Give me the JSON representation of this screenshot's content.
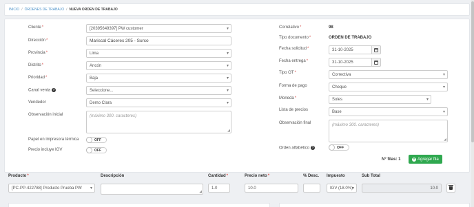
{
  "breadcrumb": {
    "items": [
      "INICIO",
      "ÓRDENES DE TRABAJO"
    ],
    "separator": "/",
    "current": "NUEVA ORDEN DE TRABAJO"
  },
  "left_form": {
    "cliente": {
      "label": "Cliente",
      "value": "[20395649397] PW customer"
    },
    "direccion": {
      "label": "Dirección",
      "value": "Mariscal Cáceres 205 - Surco"
    },
    "provincia": {
      "label": "Provincia",
      "value": "Lima"
    },
    "distrito": {
      "label": "Distrito",
      "value": "Ancón"
    },
    "prioridad": {
      "label": "Prioridad",
      "value": "Baja"
    },
    "canal_venta": {
      "label": "Canal venta",
      "value": "Seleccione..."
    },
    "vendedor": {
      "label": "Vendedor",
      "value": "Demo Clara"
    },
    "observacion_inicial": {
      "label": "Observación inicial",
      "placeholder": "(máximo 300. caracteres)"
    },
    "papel_impresora": {
      "label": "Papel en impresora térmica",
      "toggle": "OFF"
    },
    "precio_igv": {
      "label": "Precio incluye IGV",
      "toggle": "OFF"
    }
  },
  "right_form": {
    "correlativo": {
      "label": "Correlativo",
      "value": "98"
    },
    "tipo_documento": {
      "label": "Tipo documento",
      "value": "ORDEN DE TRABAJO"
    },
    "fecha_solicitud": {
      "label": "Fecha solicitud",
      "value": "31-10-2025"
    },
    "fecha_entrega": {
      "label": "Fecha entrega",
      "value": "31-10-2025"
    },
    "tipo_ot": {
      "label": "Tipo OT",
      "value": "Correctiva"
    },
    "forma_pago": {
      "label": "Forma de pago",
      "value": "Cheque"
    },
    "moneda": {
      "label": "Moneda",
      "value": "Soles"
    },
    "lista_precios": {
      "label": "Lista de precios",
      "value": "Base"
    },
    "observacion_final": {
      "label": "Observación final",
      "placeholder": "(máximo 300. caracteres)"
    },
    "orden_alfabetico": {
      "label": "Orden alfabético",
      "toggle": "OFF"
    }
  },
  "rows": {
    "label": "N° filas:",
    "count": "1",
    "add_button": "Agregar fila"
  },
  "table": {
    "headers": {
      "producto": "Producto",
      "descripcion": "Descripción",
      "cantidad": "Cantidad",
      "precio_neto": "Precio neto",
      "desc": "% Desc.",
      "impuesto": "Impuesto",
      "subtotal": "Sub Total"
    },
    "row": {
      "producto": "[PC-PP-422788] Producto Prueba PW",
      "descripcion": "",
      "cantidad": "1.0",
      "precio_neto": "10.0",
      "desc": "",
      "impuesto": "IGV (18.0%)",
      "subtotal": "10.0"
    }
  },
  "colors": {
    "accent_link": "#4a90c8",
    "required": "#d9534f",
    "add_button": "#2fa84f"
  },
  "icons": [
    "calendar-icon",
    "info-icon",
    "plus-icon",
    "trash-icon",
    "chevron-down-icon"
  ]
}
